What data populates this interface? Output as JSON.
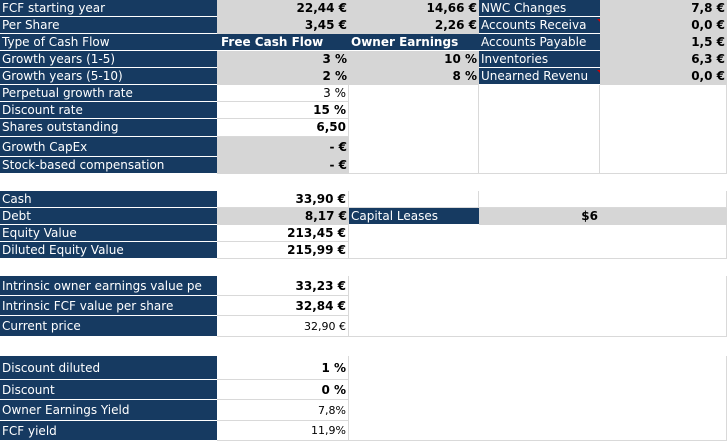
{
  "labels": {
    "fcf_starting_year": "FCF starting year",
    "per_share": "Per Share",
    "type_of_cash_flow": "Type of Cash Flow",
    "growth_1_5": "Growth years (1-5)",
    "growth_5_10": "Growth years (5-10)",
    "perpetual_growth": "Perpetual growth rate",
    "discount_rate": "Discount rate",
    "shares_outstanding": "Shares outstanding",
    "growth_capex": "Growth CapEx",
    "sbc": "Stock-based compensation",
    "cash": "Cash",
    "debt": "Debt",
    "equity_value": "Equity Value",
    "diluted_equity_value": "Diluted Equity Value",
    "intrinsic_oe": "Intrinsic owner earnings value pe",
    "intrinsic_fcf": "Intrinsic FCF value per share",
    "current_price": "Current price",
    "discount_diluted": "Discount diluted",
    "discount": "Discount",
    "oe_yield": "Owner Earnings Yield",
    "fcf_yield": "FCF yield"
  },
  "values": {
    "fcf_starting_year": "22,44 €",
    "per_share": "3,45 €",
    "growth_1_5": "3 %",
    "growth_5_10": "2 %",
    "perpetual_growth": "3 %",
    "discount_rate": "15 %",
    "shares_outstanding": "6,50",
    "growth_capex": "-   €",
    "sbc": "-   €",
    "cash": "33,90 €",
    "debt": "8,17 €",
    "equity_value": "213,45 €",
    "diluted_equity_value": "215,99 €",
    "intrinsic_oe": "33,23 €",
    "intrinsic_fcf": "32,84 €",
    "current_price": "32,90 €",
    "discount_diluted": "1 %",
    "discount": "0 %",
    "oe_yield": "7,8%",
    "fcf_yield": "11,9%"
  },
  "cash_flow_types": {
    "fcf": "Free Cash Flow",
    "owner_earnings": "Owner Earnings"
  },
  "owner_earnings": {
    "starting": "14,66 €",
    "per_share": "2,26 €",
    "growth_1_5": "10 %",
    "growth_5_10": "8 %"
  },
  "nwc": {
    "title": "NWC Changes",
    "title_value": "7,8 €",
    "items": [
      {
        "label": "Accounts Receiva",
        "value": "0,0 €"
      },
      {
        "label": "Accounts Payable",
        "value": "1,5 €"
      },
      {
        "label": "Inventories",
        "value": "6,3 €"
      },
      {
        "label": "Unearned Revenu",
        "value": "0,0 €"
      }
    ]
  },
  "capital_leases": {
    "label": "Capital Leases",
    "value": "$6"
  },
  "colors": {
    "label_bg": "#163a61",
    "input_bg": "#d6d6d6",
    "comment_marker": "#d00000"
  }
}
